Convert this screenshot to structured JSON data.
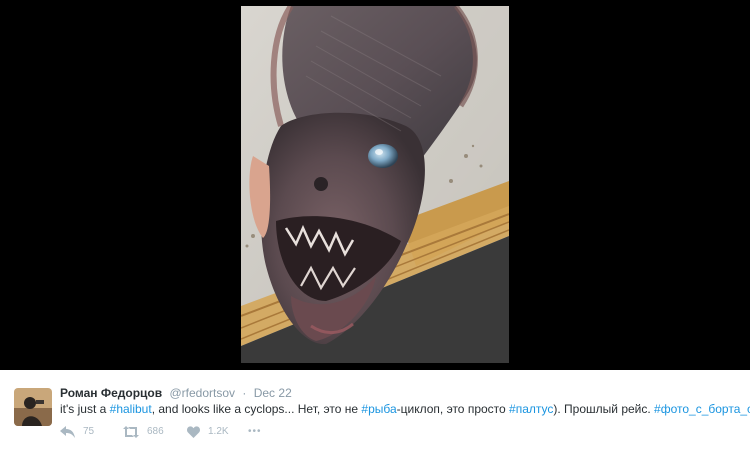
{
  "media": {
    "alt_icon": "photo-of-halibut-fish"
  },
  "tweet": {
    "author": {
      "name": "Роман Федорцов",
      "handle": "@rfedortsov",
      "avatar_icon": "avatar-image"
    },
    "separator": "·",
    "date": "Dec 22",
    "text": {
      "t1": "it's just a ",
      "h1": "#halibut",
      "t2": ", and looks like a cyclops... Нет, это не ",
      "h2": "#рыба",
      "t3": "-циклоп, это просто ",
      "h3": "#палтус",
      "t4": "). Прошлый рейс. ",
      "h4": "#фото_с_борта_судна"
    },
    "stats": {
      "replies": "75",
      "retweets": "686",
      "likes": "1.2K"
    },
    "actions": {
      "reply_icon": "reply-icon",
      "retweet_icon": "retweet-icon",
      "like_icon": "heart-icon",
      "more_icon": "more-icon",
      "more_label": "•••"
    }
  },
  "colors": {
    "hashtag": "#1b95e0",
    "muted": "#8899a6",
    "action_gray": "#aab8c2",
    "text": "#292f33"
  }
}
